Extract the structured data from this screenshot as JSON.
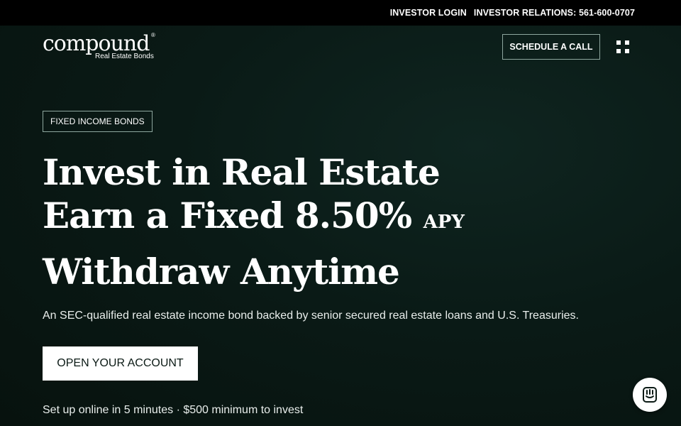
{
  "topbar": {
    "investor_login": "INVESTOR LOGIN",
    "investor_relations": "INVESTOR RELATIONS: 561-600-0707"
  },
  "logo": {
    "wordmark": "compound",
    "registered": "®",
    "subtitle": "Real Estate Bonds"
  },
  "nav": {
    "schedule_call": "SCHEDULE A CALL",
    "menu_icon": "grid-menu-icon"
  },
  "hero": {
    "badge": "FIXED INCOME BONDS",
    "headline_line1": "Invest in Real Estate",
    "headline_line2": "Earn a Fixed 8.50%",
    "headline_apy": "APY",
    "headline_line3": "Withdraw Anytime",
    "description": "An SEC-qualified real estate income bond backed by senior secured real estate loans and U.S. Treasuries.",
    "cta": "OPEN YOUR ACCOUNT",
    "setup_note": "Set up online in 5 minutes · $500 minimum to invest"
  },
  "chat": {
    "icon": "chat-icon"
  },
  "colors": {
    "background": "#08140f",
    "topbar": "#000000",
    "text": "#ffffff",
    "border": "#8ea79f",
    "cta_bg": "#ffffff",
    "cta_text": "#0b1a15"
  }
}
